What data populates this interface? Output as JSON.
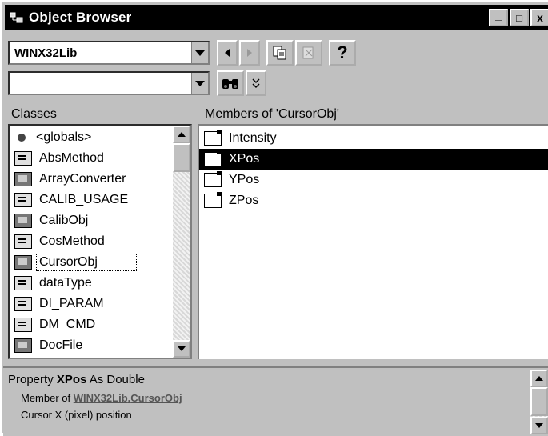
{
  "window": {
    "title": "Object Browser",
    "controls": {
      "minimize": "_",
      "maximize": "□",
      "close": "x"
    }
  },
  "library_combo": {
    "value": "WINX32Lib"
  },
  "search_combo": {
    "value": ""
  },
  "toolbar": {
    "help_glyph": "?",
    "find_glyph": "🔍",
    "toggle_glyph": "⌄"
  },
  "classes": {
    "header": "Classes",
    "items": [
      {
        "label": "<globals>",
        "icon": "globals-icon"
      },
      {
        "label": "AbsMethod",
        "icon": "enum-icon"
      },
      {
        "label": "ArrayConverter",
        "icon": "class-icon"
      },
      {
        "label": "CALIB_USAGE",
        "icon": "enum-icon"
      },
      {
        "label": "CalibObj",
        "icon": "class-icon"
      },
      {
        "label": "CosMethod",
        "icon": "enum-icon"
      },
      {
        "label": "CursorObj",
        "icon": "class-icon"
      },
      {
        "label": "dataType",
        "icon": "enum-icon"
      },
      {
        "label": "DI_PARAM",
        "icon": "enum-icon"
      },
      {
        "label": "DM_CMD",
        "icon": "enum-icon"
      },
      {
        "label": "DocFile",
        "icon": "class-icon"
      }
    ],
    "focused_index": 6
  },
  "members": {
    "header": "Members of 'CursorObj'",
    "items": [
      {
        "label": "Intensity",
        "icon": "property-icon"
      },
      {
        "label": "XPos",
        "icon": "property-icon"
      },
      {
        "label": "YPos",
        "icon": "property-icon"
      },
      {
        "label": "ZPos",
        "icon": "property-icon"
      }
    ],
    "selected_index": 1
  },
  "detail": {
    "prefix": "Property ",
    "name": "XPos",
    "suffix": " As Double",
    "member_of_label": "Member of ",
    "library_link": "WINX32Lib",
    "dot": ".",
    "class_link": "CursorObj",
    "description": "Cursor X (pixel) position"
  }
}
